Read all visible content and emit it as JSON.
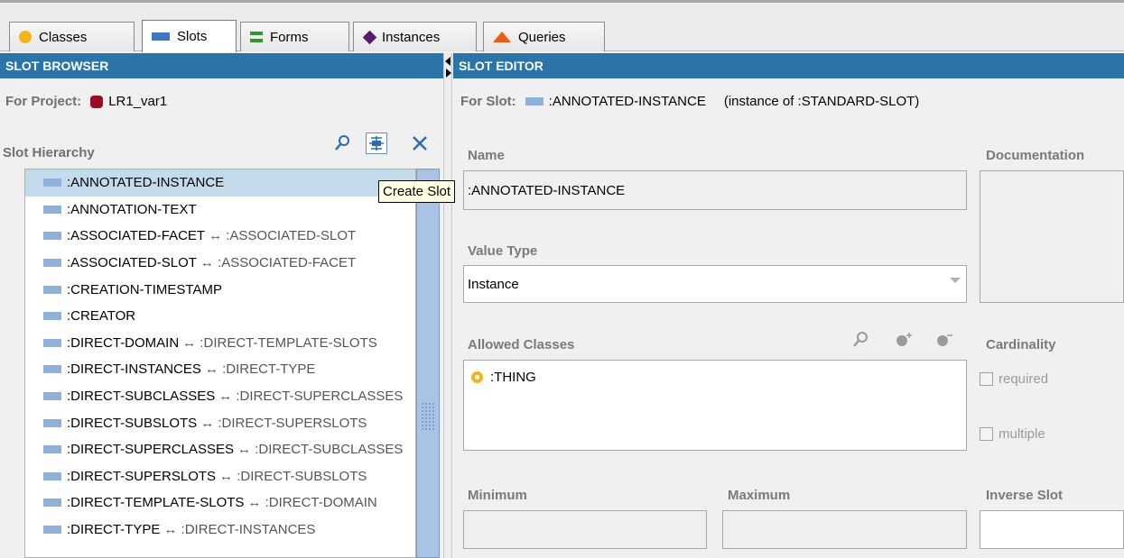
{
  "tabs": [
    {
      "label": "Classes",
      "icon": "classes-icon"
    },
    {
      "label": "Slots",
      "icon": "slots-icon"
    },
    {
      "label": "Forms",
      "icon": "forms-icon"
    },
    {
      "label": "Instances",
      "icon": "instances-icon"
    },
    {
      "label": "Queries",
      "icon": "queries-icon"
    }
  ],
  "browser": {
    "header": "SLOT BROWSER",
    "project_label": "For Project:",
    "project_name": "LR1_var1",
    "hierarchy_label": "Slot Hierarchy",
    "tooltip": "Create Slot",
    "slots": [
      {
        "name": ":ANNOTATED-INSTANCE",
        "inverse": ""
      },
      {
        "name": ":ANNOTATION-TEXT",
        "inverse": ""
      },
      {
        "name": ":ASSOCIATED-FACET",
        "inverse": "↔ :ASSOCIATED-SLOT"
      },
      {
        "name": ":ASSOCIATED-SLOT",
        "inverse": "↔ :ASSOCIATED-FACET"
      },
      {
        "name": ":CREATION-TIMESTAMP",
        "inverse": ""
      },
      {
        "name": ":CREATOR",
        "inverse": ""
      },
      {
        "name": ":DIRECT-DOMAIN",
        "inverse": "↔ :DIRECT-TEMPLATE-SLOTS"
      },
      {
        "name": ":DIRECT-INSTANCES",
        "inverse": "↔ :DIRECT-TYPE"
      },
      {
        "name": ":DIRECT-SUBCLASSES",
        "inverse": "↔ :DIRECT-SUPERCLASSES"
      },
      {
        "name": ":DIRECT-SUBSLOTS",
        "inverse": "↔ :DIRECT-SUPERSLOTS"
      },
      {
        "name": ":DIRECT-SUPERCLASSES",
        "inverse": "↔ :DIRECT-SUBCLASSES"
      },
      {
        "name": ":DIRECT-SUPERSLOTS",
        "inverse": "↔ :DIRECT-SUBSLOTS"
      },
      {
        "name": ":DIRECT-TEMPLATE-SLOTS",
        "inverse": "↔ :DIRECT-DOMAIN"
      },
      {
        "name": ":DIRECT-TYPE",
        "inverse": "↔ :DIRECT-INSTANCES"
      }
    ]
  },
  "editor": {
    "header": "SLOT EDITOR",
    "for_slot_label": "For Slot:",
    "for_slot_name": ":ANNOTATED-INSTANCE",
    "instance_of": "(instance of :STANDARD-SLOT)",
    "name_label": "Name",
    "name_value": ":ANNOTATED-INSTANCE",
    "documentation_label": "Documentation",
    "value_type_label": "Value Type",
    "value_type_value": "Instance",
    "allowed_classes_label": "Allowed Classes",
    "allowed_classes": [
      ":THING"
    ],
    "cardinality_label": "Cardinality",
    "required_label": "required",
    "multiple_label": "multiple",
    "minimum_label": "Minimum",
    "maximum_label": "Maximum",
    "inverse_slot_label": "Inverse Slot"
  },
  "colors": {
    "header": "#2b74a8",
    "selection": "#c3dbea",
    "slot_icon": "#8fb0d8"
  }
}
